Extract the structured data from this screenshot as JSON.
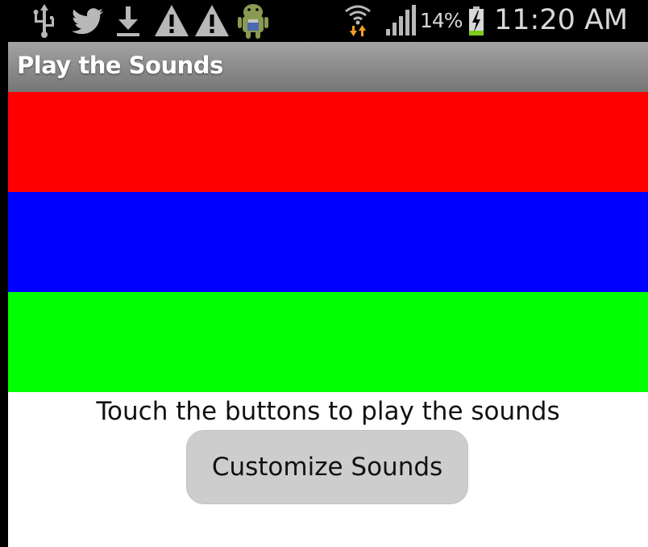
{
  "status_bar": {
    "icons_left": [
      "usb-icon",
      "twitter-icon",
      "download-icon",
      "warning-icon",
      "warning-icon",
      "android-icon"
    ],
    "icons_right": [
      "wifi-icon",
      "signal-icon",
      "battery-charging-icon"
    ],
    "battery_percent": "14%",
    "time": "11:20 AM",
    "colors": {
      "background": "#000000",
      "icon": "#b8b8b8",
      "battery_charge": "#7ecb1c",
      "wifi_arrows": "#f0a020"
    }
  },
  "title_bar": {
    "title": "Play the Sounds"
  },
  "sound_buttons": [
    {
      "color": "#ff0000"
    },
    {
      "color": "#0000ff"
    },
    {
      "color": "#00ff00"
    }
  ],
  "instruction": "Touch the buttons to play the sounds",
  "customize_button": {
    "label": "Customize Sounds"
  }
}
